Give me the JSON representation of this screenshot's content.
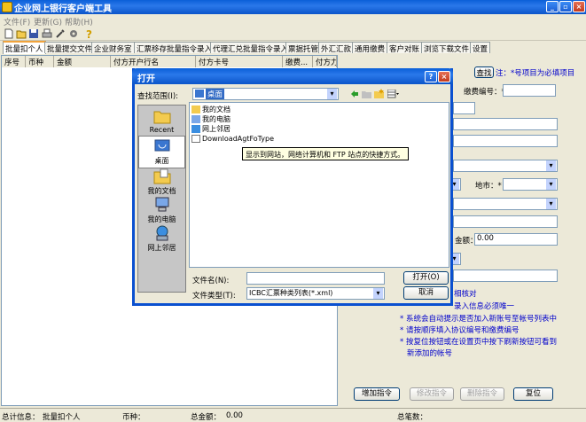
{
  "window": {
    "title": "企业网上银行客户端工具"
  },
  "menu": [
    "文件(F)",
    "更新(G)",
    "帮助(H)"
  ],
  "tabs": [
    "批量扣个人",
    "批量提交文件",
    "企业财务室",
    "汇票移存批量指令录入",
    "代理汇兑批量指令录入",
    "票据托管",
    "外汇汇款",
    "通用缴费",
    "客户对账",
    "浏览下载文件",
    "设置"
  ],
  "grid": {
    "columns": [
      "序号",
      "币种",
      "金额",
      "付方开户行名",
      "付方卡号",
      "缴费...",
      "付方力"
    ]
  },
  "right": {
    "search_button": "查找",
    "note": "注：*号项目为必填项目",
    "fee_no_label": "缴费编号：*",
    "city_label": "地市：*",
    "amount_label": "金额：*",
    "amount_value": "0.00",
    "hints": [
      "相核对",
      "录入信息必须唯一",
      "* 系统会自动提示是否加入新账号至帐号列表中",
      "* 请按顺序填入协议编号和缴费编号",
      "* 按复位按钮或在设置页中按下刷新按钮可看到",
      "新添加的帐号"
    ],
    "add_button": "增加指令",
    "modify_button": "修改指令",
    "delete_button": "删除指令",
    "reset_button": "复位"
  },
  "status": {
    "total_label": "总计信息：",
    "total_value": "批量扣个人",
    "currency_label": "币种：",
    "amount_label": "总金额：",
    "amount_value": "0.00",
    "count_label": "总笔数："
  },
  "dialog": {
    "title": "打开",
    "lookin_label": "查找范围(I):",
    "lookin_value": "桌面",
    "places": [
      "Recent",
      "桌面",
      "我的文档",
      "我的电脑",
      "网上邻居"
    ],
    "files": [
      "我的文档",
      "我的电脑",
      "网上邻居",
      "DownloadAgtFoType"
    ],
    "tooltip": "显示到网站，网络计算机和 FTP 站点的快捷方式。",
    "filename_label": "文件名(N):",
    "filename_value": "",
    "filetype_label": "文件类型(T):",
    "filetype_value": "ICBC汇票种类列表(*.xml)",
    "open_button": "打开(O)",
    "cancel_button": "取消"
  }
}
